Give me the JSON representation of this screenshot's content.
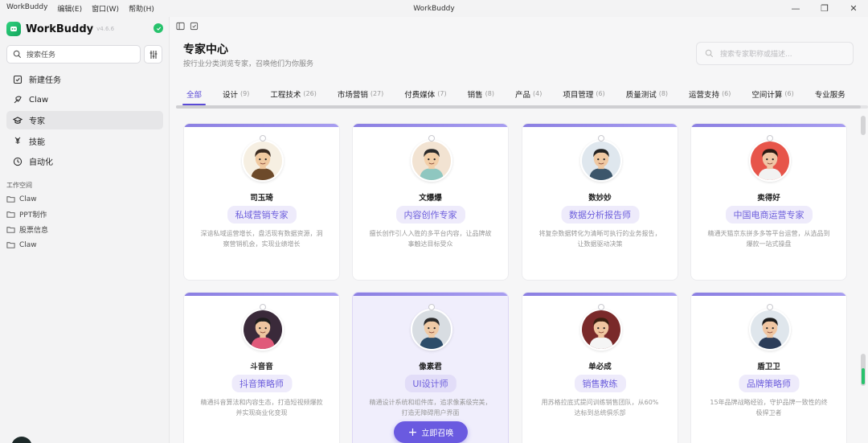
{
  "titlebar": {
    "app": "WorkBuddy",
    "menus": [
      "编辑(E)",
      "窗口(W)",
      "帮助(H)"
    ],
    "title": "WorkBuddy"
  },
  "sidebar": {
    "brand": "WorkBuddy",
    "version": "v4.6.6",
    "search_placeholder": "搜索任务",
    "nav": [
      {
        "label": "新建任务",
        "icon": "edit-icon"
      },
      {
        "label": "Claw",
        "icon": "claw-icon"
      },
      {
        "label": "专家",
        "icon": "expert-hat-icon",
        "active": true
      },
      {
        "label": "技能",
        "icon": "skill-icon"
      },
      {
        "label": "自动化",
        "icon": "clock-icon"
      }
    ],
    "workspace_title": "工作空间",
    "workspaces": [
      "Claw",
      "PPT制作",
      "股票信息",
      "Claw"
    ]
  },
  "main": {
    "title": "专家中心",
    "subtitle": "按行业分类浏览专家，召唤他们为你服务",
    "search_placeholder": "搜索专家职称或描述...",
    "tabs": [
      {
        "label": "全部",
        "count": "",
        "active": true
      },
      {
        "label": "设计",
        "count": "(9)"
      },
      {
        "label": "工程技术",
        "count": "(26)"
      },
      {
        "label": "市场营销",
        "count": "(27)"
      },
      {
        "label": "付费媒体",
        "count": "(7)"
      },
      {
        "label": "销售",
        "count": "(8)"
      },
      {
        "label": "产品",
        "count": "(4)"
      },
      {
        "label": "项目管理",
        "count": "(6)"
      },
      {
        "label": "质量测试",
        "count": "(8)"
      },
      {
        "label": "运营支持",
        "count": "(6)"
      },
      {
        "label": "空间计算",
        "count": "(6)"
      },
      {
        "label": "专业服务",
        "count": ""
      }
    ],
    "experts": [
      {
        "name": "司玉琦",
        "role": "私域营销专家",
        "desc": "深谙私域运营增长，盘活现有数据资源，洞察营销机会，实现业绩增长",
        "bg": "#f6efe2",
        "skin": "#f0c9a0",
        "hair": "#3a2a20",
        "shirt": "#6d4a2a"
      },
      {
        "name": "文爆爆",
        "role": "内容创作专家",
        "desc": "擅长创作引人入胜的多平台内容，让品牌故事触达目标受众",
        "bg": "#f2e3d2",
        "skin": "#f3cfa8",
        "hair": "#2a2a2a",
        "shirt": "#8fc7c0"
      },
      {
        "name": "数妙妙",
        "role": "数据分析报告师",
        "desc": "将复杂数据转化为清晰可执行的业务报告，让数据驱动决策",
        "bg": "#dfe7ee",
        "skin": "#efc8a2",
        "hair": "#222",
        "shirt": "#3c566b"
      },
      {
        "name": "卖得好",
        "role": "中国电商运营专家",
        "desc": "精通天猫京东拼多多等平台运营，从选品到爆款一站式操盘",
        "bg": "#e7554a",
        "skin": "#f0c6a6",
        "hair": "#2a1a14",
        "shirt": "#f2f2f2"
      },
      {
        "name": "斗音音",
        "role": "抖音策略师",
        "desc": "精通抖音算法和内容生态，打造短视频爆款并实现商业化变现",
        "bg": "#3a2a3a",
        "skin": "#eec5a0",
        "hair": "#1d1d1d",
        "shirt": "#e05a7a"
      },
      {
        "name": "像素君",
        "role": "UI设计师",
        "desc": "精通设计系统和组件库，追求像素级完美，打造无障碍用户界面",
        "bg": "#d8dde2",
        "skin": "#efcaa6",
        "hair": "#2a2a2a",
        "shirt": "#2d4d6a",
        "highlight": true
      },
      {
        "name": "单必成",
        "role": "销售教练",
        "desc": "用苏格拉底式提问训练销售团队，从60%达标到总统俱乐部",
        "bg": "#7a2a2a",
        "skin": "#f0c6a0",
        "hair": "#3a2010",
        "shirt": "#f5f5f5"
      },
      {
        "name": "盾卫卫",
        "role": "品牌策略师",
        "desc": "15年品牌战略经验，守护品牌一致性的终极捍卫者",
        "bg": "#dfe6ec",
        "skin": "#f0c6a2",
        "hair": "#1c1c1c",
        "shirt": "#2d3e5a"
      }
    ],
    "summon_label": "立即召唤"
  }
}
